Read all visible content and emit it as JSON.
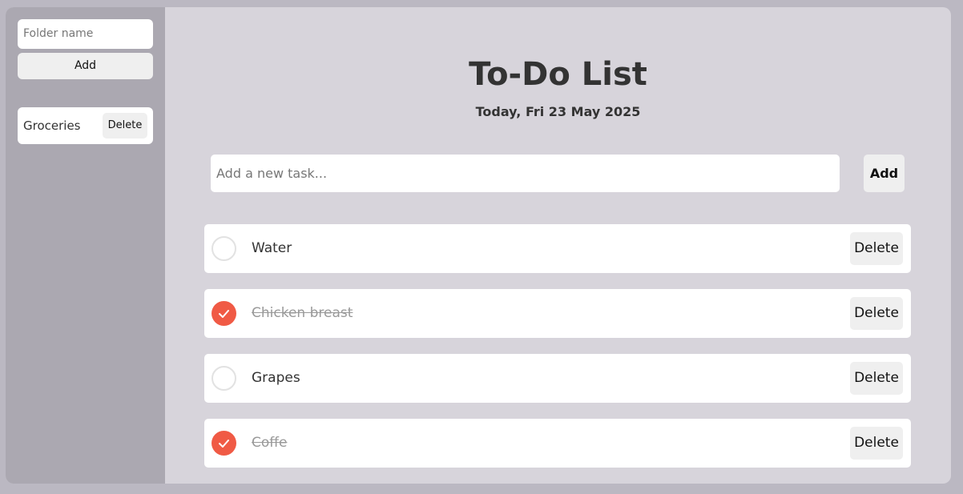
{
  "sidebar": {
    "folder_input_placeholder": "Folder name",
    "add_label": "Add",
    "folders": [
      {
        "name": "Groceries",
        "delete_label": "Delete"
      }
    ]
  },
  "main": {
    "title": "To-Do List",
    "date": "Today, Fri 23 May 2025",
    "task_input_placeholder": "Add a new task...",
    "add_label": "Add",
    "tasks": [
      {
        "text": "Water",
        "done": false,
        "delete_label": "Delete"
      },
      {
        "text": "Chicken breast",
        "done": true,
        "delete_label": "Delete"
      },
      {
        "text": "Grapes",
        "done": false,
        "delete_label": "Delete"
      },
      {
        "text": "Coffe",
        "done": true,
        "delete_label": "Delete"
      }
    ]
  },
  "colors": {
    "accent": "#f05a45",
    "background": "#bbb8c2",
    "sidebar": "#aba8b1",
    "main": "#d7d4db"
  }
}
